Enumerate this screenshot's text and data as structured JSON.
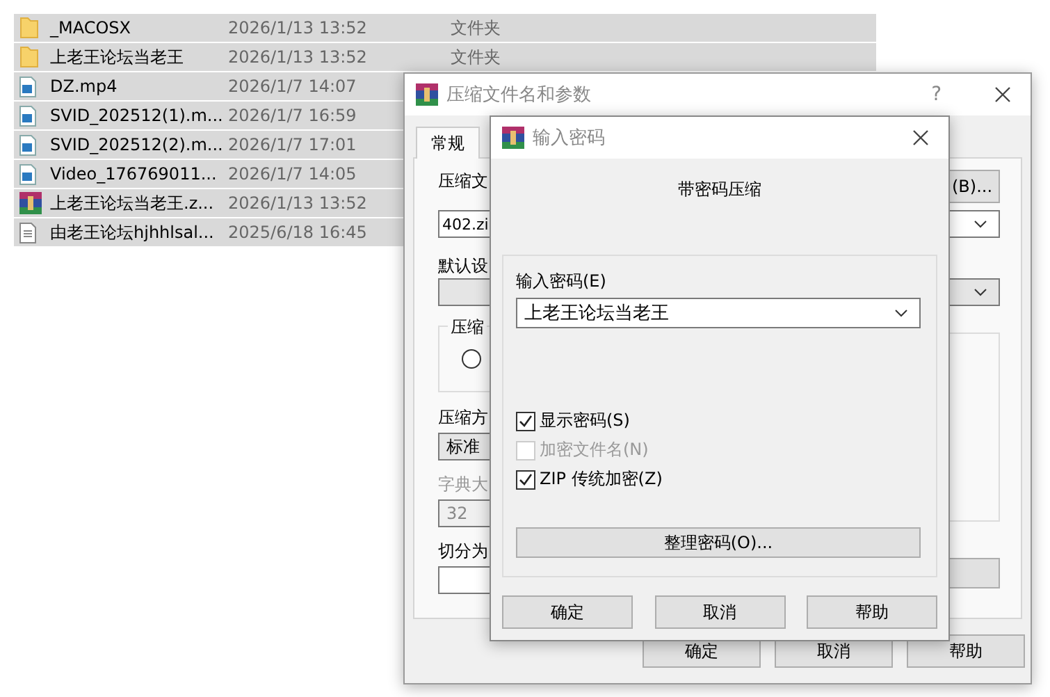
{
  "file_list": {
    "rows": [
      {
        "kind": "folder",
        "name": "_MACOSX",
        "date": "2026/1/13 13:52",
        "type": "文件夹"
      },
      {
        "kind": "folder",
        "name": "上老王论坛当老王",
        "date": "2026/1/13 13:52",
        "type": "文件夹"
      },
      {
        "kind": "video",
        "name": "DZ.mp4",
        "date": "2026/1/7 14:07"
      },
      {
        "kind": "video",
        "name": "SVID_202512(1).m...",
        "date": "2026/1/7 16:59"
      },
      {
        "kind": "video",
        "name": "SVID_202512(2).m...",
        "date": "2026/1/7 17:01"
      },
      {
        "kind": "video",
        "name": "Video_176769011...",
        "date": "2026/1/7 14:05"
      },
      {
        "kind": "archive",
        "name": "上老王论坛当老王.z...",
        "date": "2026/1/13 13:52"
      },
      {
        "kind": "text",
        "name": "由老王论坛hjhhlsal...",
        "date": "2025/6/18 16:45"
      }
    ]
  },
  "archive_dialog": {
    "title": "压缩文件名和参数",
    "help": "?",
    "tabs": [
      {
        "label": "常规",
        "selected": true
      }
    ],
    "archive_name_label": "压缩文",
    "archive_name": "402.zi",
    "browse_button": "(B)...",
    "profile_label": "默认设",
    "format_group": "压缩",
    "format_options": [
      {
        "selected": false
      }
    ],
    "method_label": "压缩方",
    "method": "标准",
    "dictionary": {
      "label": "字典大",
      "value": "32",
      "disabled": true
    },
    "split_label": "切分为",
    "buttons": [
      "确定",
      "取消",
      "帮助"
    ]
  },
  "password_dialog": {
    "title": "输入密码",
    "heading": "带密码压缩",
    "password_label": "输入密码(E)",
    "password": "上老王论坛当老王",
    "checkboxes": [
      {
        "label": "显示密码(S)",
        "checked": true,
        "disabled": false
      },
      {
        "label": "加密文件名(N)",
        "checked": false,
        "disabled": true
      },
      {
        "label": "ZIP 传统加密(Z)",
        "checked": true,
        "disabled": false
      }
    ],
    "organize_button": "整理密码(O)...",
    "buttons": [
      "确定",
      "取消",
      "帮助"
    ]
  }
}
